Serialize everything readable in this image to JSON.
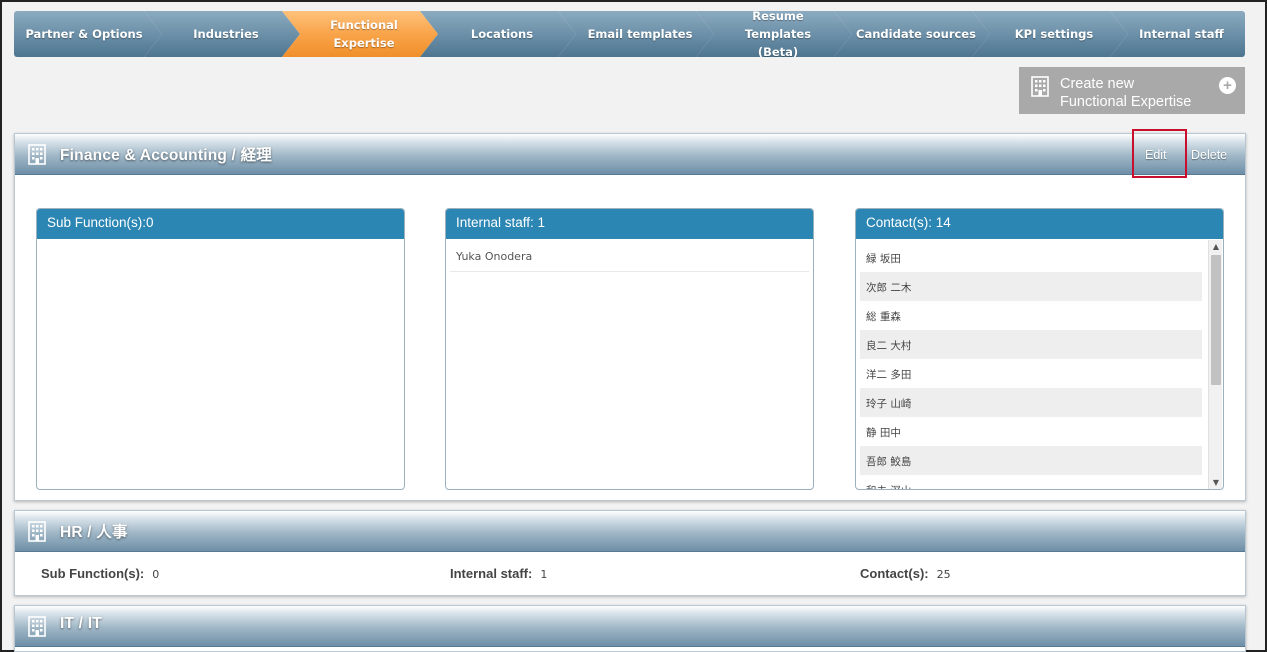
{
  "steps": [
    {
      "label": "Partner & Options",
      "active": false
    },
    {
      "label": "Industries",
      "active": false
    },
    {
      "label": "Functional Expertise",
      "line1": "Functional",
      "line2": "Expertise",
      "active": true
    },
    {
      "label": "Locations",
      "active": false
    },
    {
      "label": "Email templates",
      "active": false
    },
    {
      "label": "Resume Templates (Beta)",
      "line1": "Resume Templates",
      "line2": "(Beta)",
      "active": false
    },
    {
      "label": "Candidate sources",
      "active": false
    },
    {
      "label": "KPI settings",
      "active": false
    },
    {
      "label": "Internal staff",
      "active": false
    }
  ],
  "create_button": {
    "line1": "Create new",
    "line2": "Functional Expertise",
    "plus": "+"
  },
  "panels": {
    "finance": {
      "title": "Finance & Accounting / 経理",
      "edit_label": "Edit",
      "delete_label": "Delete",
      "sub_function_header": "Sub Function(s):0",
      "internal_staff_header": "Internal staff: 1",
      "internal_staff": [
        "Yuka Onodera"
      ],
      "contacts_header": "Contact(s): 14",
      "contacts": [
        "緑 坂田",
        "次郎 二木",
        "総 重森",
        "良二 大村",
        "洋二 多田",
        "玲子 山崎",
        "静 田中",
        "吾郎 鮫島",
        "和夫 深山"
      ]
    },
    "hr": {
      "title": "HR / 人事",
      "sub_function_label": "Sub Function(s):",
      "sub_function_value": "0",
      "internal_staff_label": "Internal staff:",
      "internal_staff_value": "1",
      "contacts_label": "Contact(s):",
      "contacts_value": "25"
    },
    "it": {
      "title": "IT / IT"
    }
  }
}
